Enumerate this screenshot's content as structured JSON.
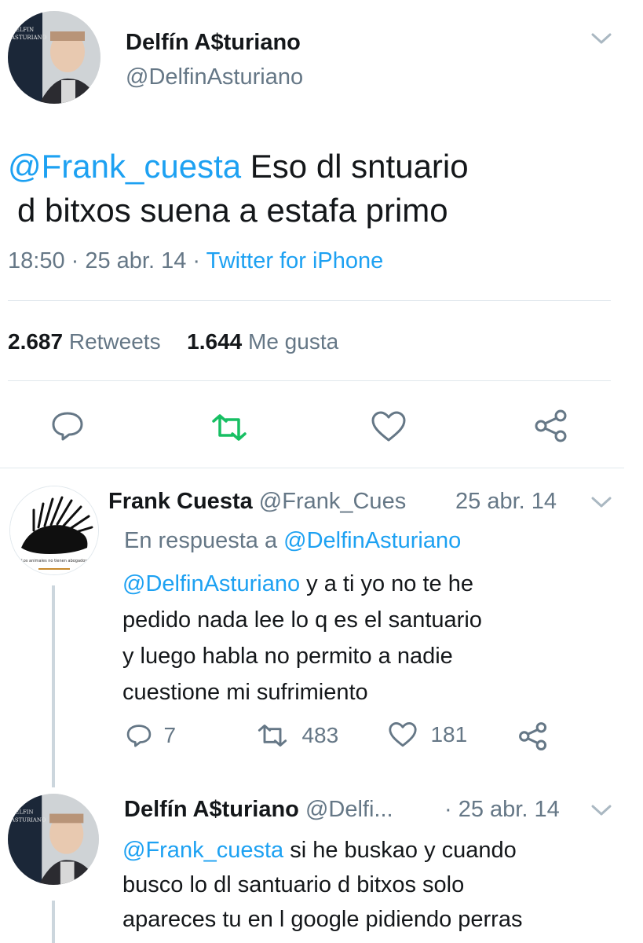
{
  "main_tweet": {
    "display_name": "Delfín A$turiano",
    "handle": "@DelfinAsturiano",
    "mention": "@Frank_cuesta",
    "text_line1": "Eso dl sntuario",
    "text_line2": "d bitxos  suena a estafa primo",
    "time": "18:50",
    "date": "25 abr. 14",
    "source": "Twitter for iPhone",
    "retweets_count": "2.687",
    "retweets_label": "Retweets",
    "likes_count": "1.644",
    "likes_label": "Me gusta",
    "avatar_texts": [
      "DELFIN",
      "ASTURIANO"
    ]
  },
  "reply1": {
    "display_name": "Frank Cuesta",
    "handle": "@Frank_Cues",
    "date": "25 abr. 14",
    "in_reply_prefix": "En respuesta a",
    "in_reply_handle": "@DelfinAsturiano",
    "mention": "@DelfinAsturiano",
    "text_line1": "y a ti yo no te he",
    "text_line2": "pedido nada lee lo q es el santuario",
    "text_line3": "y luego habla no permito a  nadie",
    "text_line4": "cuestione mi sufrimiento",
    "replies": "7",
    "retweets": "483",
    "likes": "181",
    "avatar_caption": "Los animales no tienen abogados"
  },
  "reply2": {
    "display_name": "Delfín A$turiano",
    "handle": "@Delfi...",
    "date": "· 25 abr. 14",
    "mention": "@Frank_cuesta",
    "text_line1": "si he buskao y cuando",
    "text_line2": "busco lo dl santuario d bitxos   solo",
    "text_line3": "apareces tu en l google pidiendo perras"
  },
  "colors": {
    "blue": "#1da1f2",
    "retweet_green": "#17bf63",
    "gray_text": "#657786",
    "divider": "#e1e8ed"
  },
  "icons": [
    "chevron-down-icon",
    "reply-icon",
    "retweet-icon",
    "like-icon",
    "share-icon"
  ]
}
